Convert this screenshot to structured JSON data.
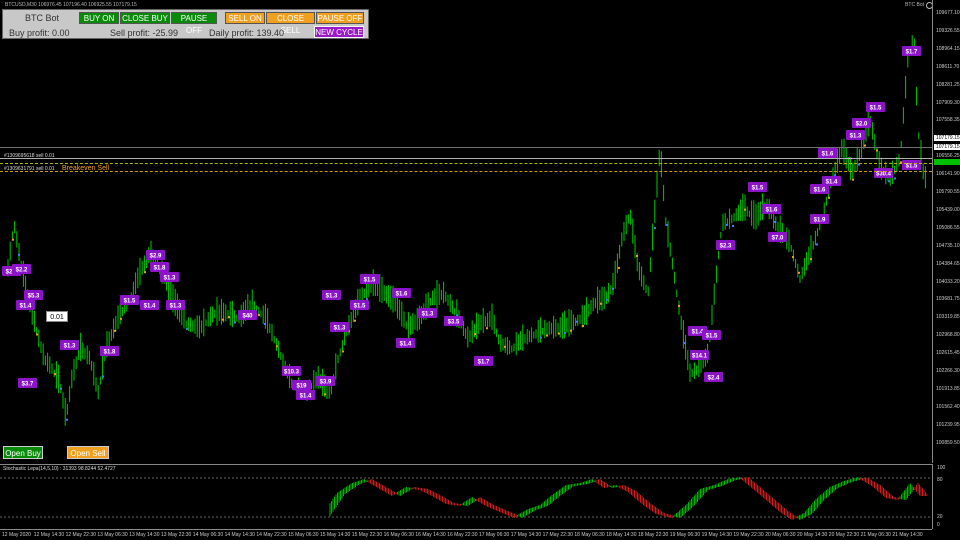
{
  "titlebar": {
    "symbol_text": "BTCUSD,M30  106976.45 107196.40 106925.55 107179.15",
    "bot_name": "BTC Bot"
  },
  "panel": {
    "title": "BTC Bot",
    "buttons": {
      "buy_on": "BUY ON",
      "close_buy": "CLOSE BUY",
      "pause_buy": "PAUSE OFF",
      "sell_on": "SELL ON",
      "close_sell": "CLOSE SELL",
      "pause_sell": "PAUSE OFF",
      "new_cycle": "NEW CYCLE"
    },
    "buy_profit": "Buy profit: 0.00",
    "sell_profit": "Sell profit: -25.99",
    "daily_profit": "Daily profit: 139.40"
  },
  "lines": {
    "order1": "#1309695618 sell 0.01",
    "order2": "#1309631791 sell 0.01",
    "breakeven": "Breakeven Sell"
  },
  "tooltip": "0.01",
  "bottom_buttons": {
    "open_buy": "Open Buy",
    "open_sell": "Open Sell"
  },
  "price_axis": {
    "labels": [
      "109677.10",
      "109326.55",
      "108964.15",
      "108611.70",
      "108281.25",
      "107909.30",
      "107558.35",
      "107179.15",
      "106556.25",
      "106141.90",
      "105790.55",
      "105439.00",
      "105086.55",
      "104735.10",
      "104384.65",
      "104033.20",
      "103681.75",
      "103319.85",
      "102968.80",
      "102615.45",
      "102266.30",
      "101913.85",
      "101562.40",
      "101239.95",
      "100859.50"
    ],
    "current": "107179.15"
  },
  "stochastic": {
    "title": "Stochastic Lepa(14,5,10) : 31393 98.8244 52.4727",
    "axis": [
      "100",
      "80",
      "20",
      "0"
    ]
  },
  "time_axis": [
    "12 May 2020",
    "12 May 14:30",
    "12 May 22:30",
    "13 May 06:30",
    "13 May 14:30",
    "13 May 22:30",
    "14 May 06:30",
    "14 May 14:30",
    "14 May 22:30",
    "15 May 06:30",
    "15 May 14:30",
    "15 May 22:30",
    "16 May 06:30",
    "16 May 14:30",
    "16 May 22:30",
    "17 May 06:30",
    "17 May 14:30",
    "17 May 22:30",
    "18 May 06:30",
    "18 May 14:30",
    "18 May 22:30",
    "19 May 06:30",
    "19 May 14:30",
    "19 May 22:30",
    "20 May 06:30",
    "20 May 14:30",
    "20 May 22:30",
    "21 May 06:30",
    "21 May 14:30"
  ],
  "profit_tags": [
    "$2.1",
    "$2.2",
    "$5.3",
    "$1.4",
    "$3.7",
    "$1.3",
    "$1.8",
    "$1.5",
    "$1.4",
    "$2.9",
    "$1.8",
    "$1.3",
    "$1.3",
    "$40",
    "$1.3",
    "$1.5",
    "$10.3",
    "$19",
    "$1.4",
    "$3.9",
    "$1.3",
    "$1.5",
    "$1.6",
    "$1.4",
    "$1.3",
    "$3.5",
    "$1.7",
    "$1.4",
    "$2.4",
    "$14.1",
    "$1.5",
    "$1.5",
    "$2.3",
    "$1.6",
    "$7.0",
    "$1.9",
    "$1.3",
    "$1.6",
    "$2.0",
    "$1.4",
    "$1.5",
    "$1.6",
    "$30.4",
    "$1.7",
    "$1.5"
  ],
  "colors": {
    "candle_up": "#00c800",
    "line_dashed": "#b4b400",
    "tag_bg": "#8c14c8",
    "stoch_up": "#00b400",
    "stoch_down": "#c81e1e"
  }
}
